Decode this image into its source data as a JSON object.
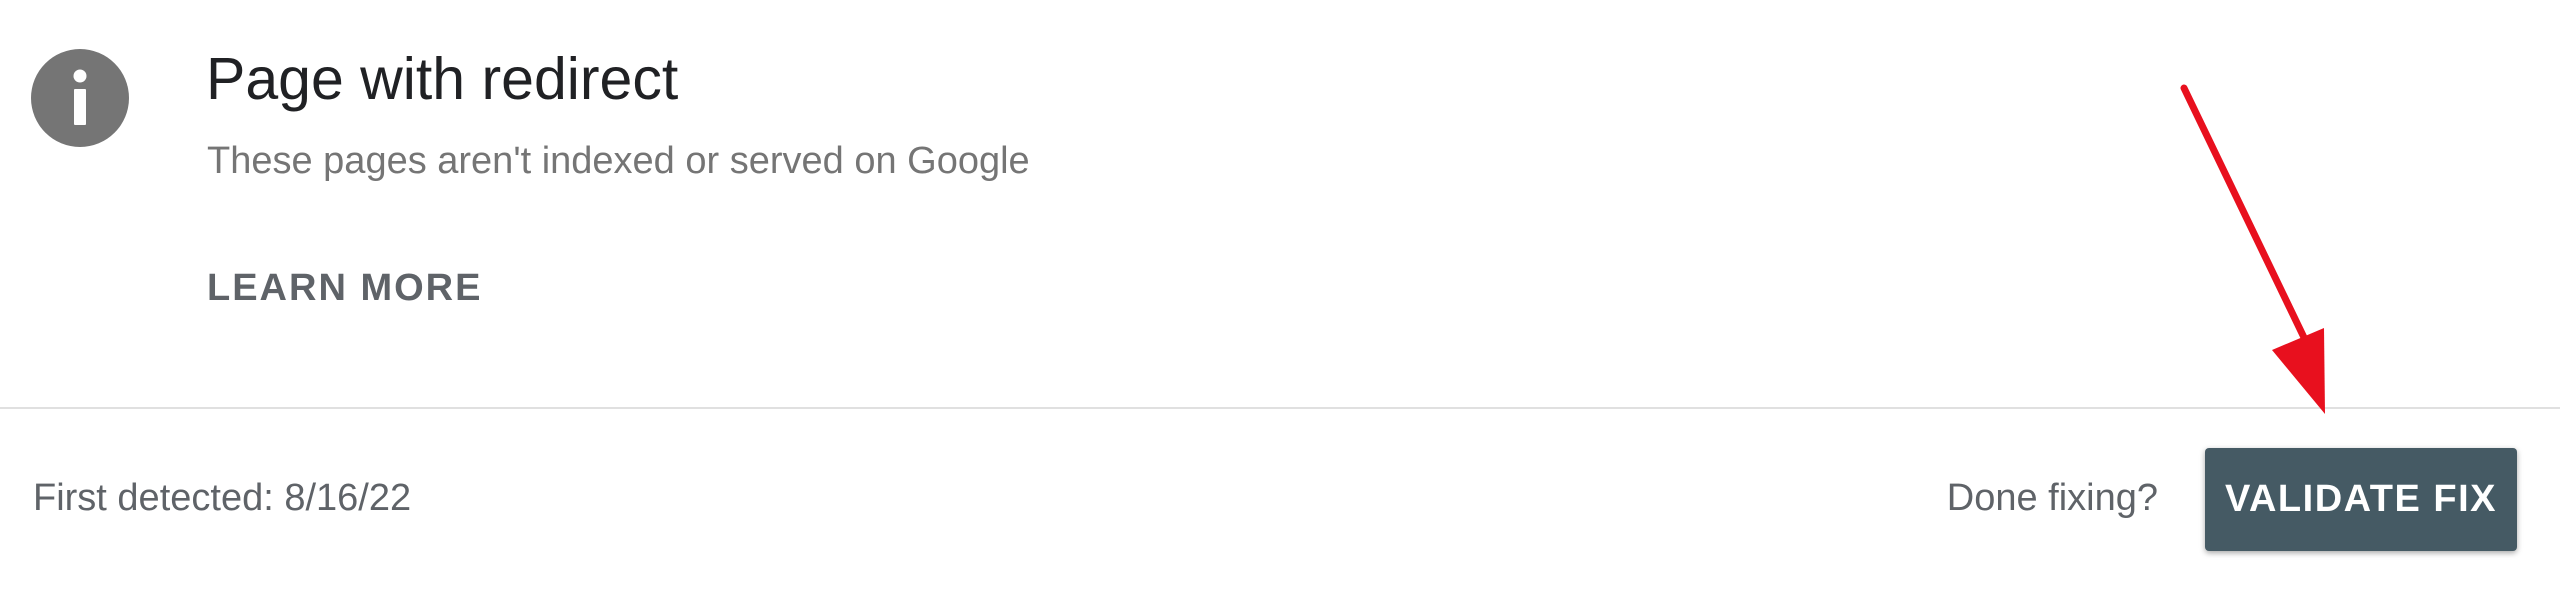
{
  "issue": {
    "icon": "info-icon",
    "title": "Page with redirect",
    "description": "These pages aren't indexed or served on Google",
    "learn_more_label": "LEARN MORE"
  },
  "footer": {
    "first_detected": "First detected: 8/16/22",
    "done_fixing": "Done fixing?",
    "validate_fix_label": "VALIDATE FIX"
  },
  "colors": {
    "button_background": "#455a64",
    "icon_background": "#757575",
    "annotation_arrow": "#e8101e"
  }
}
